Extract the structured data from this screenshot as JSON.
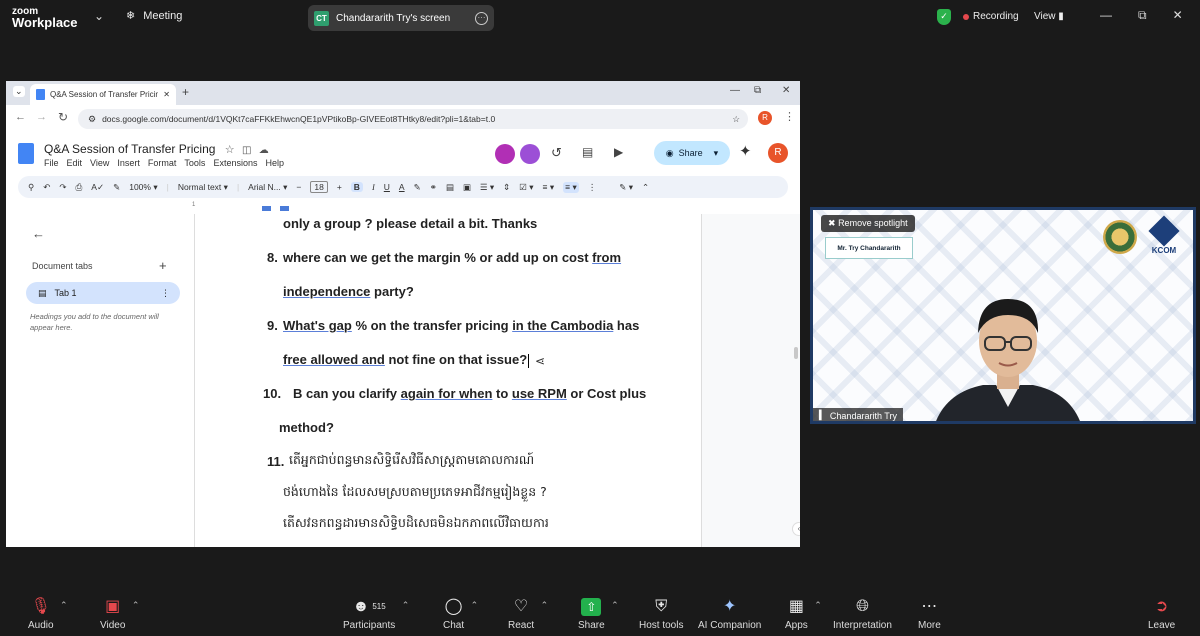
{
  "zoom": {
    "logo_line1": "zoom",
    "logo_line2": "Workplace",
    "meeting_label": "Meeting",
    "share_badge": "CT",
    "share_label": "Chandararith Try's screen",
    "recording_label": "Recording",
    "view_label": "View",
    "bottom": [
      {
        "label": "Audio",
        "icon": "mic-muted-icon"
      },
      {
        "label": "Video",
        "icon": "video-off-icon"
      },
      {
        "label": "Participants",
        "icon": "participants-icon",
        "count": "515"
      },
      {
        "label": "Chat",
        "icon": "chat-icon"
      },
      {
        "label": "React",
        "icon": "heart-icon"
      },
      {
        "label": "Share",
        "icon": "share-screen-icon"
      },
      {
        "label": "Host tools",
        "icon": "shield-icon"
      },
      {
        "label": "AI Companion",
        "icon": "sparkle-icon"
      },
      {
        "label": "Apps",
        "icon": "apps-icon"
      },
      {
        "label": "Interpretation",
        "icon": "globe-icon"
      },
      {
        "label": "More",
        "icon": "more-icon"
      },
      {
        "label": "Leave",
        "icon": "leave-icon"
      }
    ]
  },
  "browser": {
    "tab_title": "Q&A Session of Transfer Pricing",
    "url": "docs.google.com/document/d/1VQKt7caFFKkEhwcnQE1pVPtikoBp-GIVEEot8THtky8/edit?pli=1&tab=t.0",
    "profile_initial": "R"
  },
  "docs": {
    "title": "Q&A Session of Transfer Pricing",
    "menu": [
      "File",
      "Edit",
      "View",
      "Insert",
      "Format",
      "Tools",
      "Extensions",
      "Help"
    ],
    "share_label": "Share",
    "zoom": "100%",
    "style": "Normal text",
    "font": "Arial N...",
    "font_size": "18",
    "sidebar_heading": "Document tabs",
    "tab_label": "Tab 1",
    "sidebar_hint": "Headings you add to the document will appear here.",
    "ruler_mark": "1"
  },
  "document": {
    "line_a": "only a group ? please detail a bit. Thanks",
    "q8_num": "8.",
    "q8_a": "where can we get the margin % or add up on cost ",
    "q8_b": "from",
    "q8_c": "independence",
    "q8_d": " party?",
    "q9_num": "9.",
    "q9_a": "What's gap",
    "q9_b": " % on the transfer pricing ",
    "q9_c": "in the Cambodia",
    "q9_d": " has",
    "q9_e": "free allowed and",
    "q9_f": " not fine on that issue?",
    "q10_num": "10.",
    "q10_a": "B can you clarify ",
    "q10_b": "again for when",
    "q10_c": " to ",
    "q10_d": "use RPM",
    "q10_e": " or Cost plus",
    "q10_f": "method?",
    "q11_num": "11.",
    "q11_l1": "តើអ្នកជាប់ពន្ធមានសិទ្ធិរើសវិធីសាស្ត្រតាមគោលការណ៍",
    "q11_l2": "ថង់ហោងនៃ ដែលសមស្របតាមប្រភេទអាជីវកម្មរៀងខ្លួន ?",
    "q11_l3": "តើសវនកពន្ធដារមានសិទ្ធិបដិសេធមិនឯកភាពលើវិធាយការ"
  },
  "video": {
    "spotlight_label": "Remove spotlight",
    "namecard": "Mr. Try Chandararith",
    "logo2_text": "KCOM",
    "participant_name": "Chandararith Try"
  },
  "colors": {
    "zoom_bg": "#1a1a1a",
    "docs_blue": "#4285f4",
    "share_btn": "#c2e7ff",
    "recording_red": "#e5484d",
    "secure_green": "#2bb24c"
  }
}
